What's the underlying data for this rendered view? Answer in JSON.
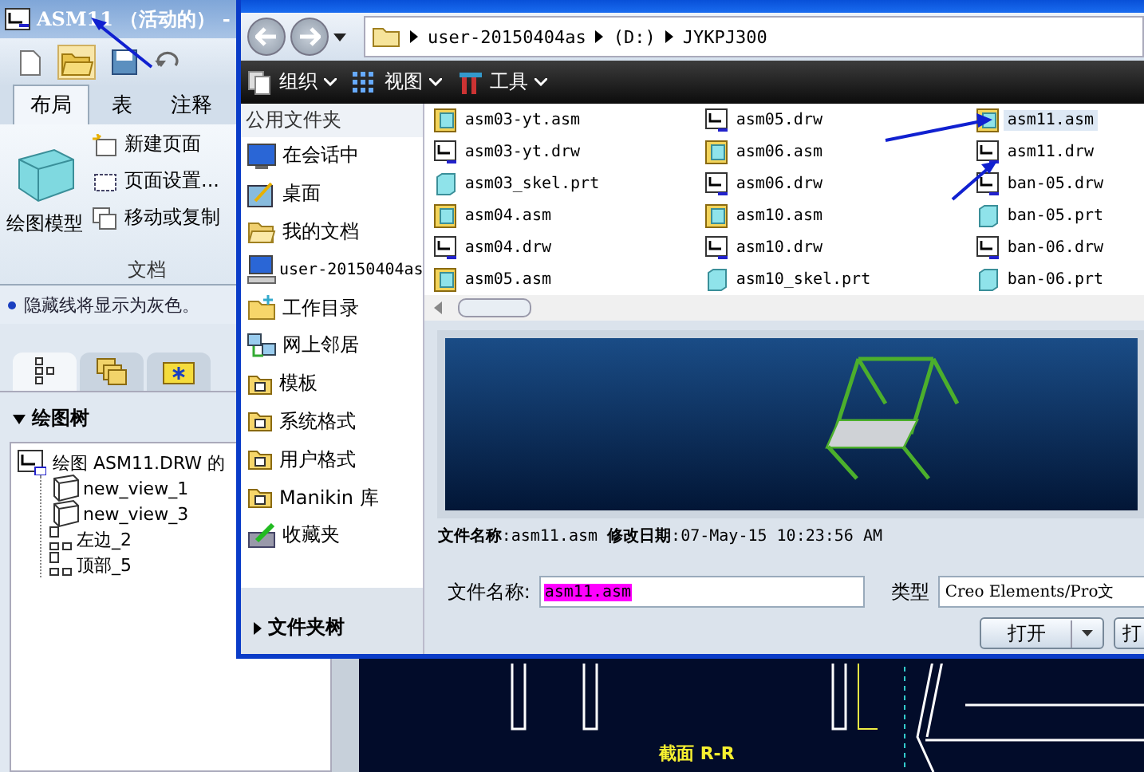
{
  "app": {
    "title": "ASM11 （活动的） -",
    "ribbon_tabs": [
      {
        "label": "布局",
        "selected": true
      },
      {
        "label": "表",
        "selected": false
      },
      {
        "label": "注释",
        "selected": false
      }
    ],
    "ribbon": {
      "big_button": "绘图模型",
      "commands": [
        {
          "label": "新建页面",
          "kind": "new"
        },
        {
          "label": "页面设置...",
          "kind": "setup"
        },
        {
          "label": "移动或复制",
          "kind": "move"
        }
      ],
      "group_label": "文档"
    },
    "message": "隐藏线将显示为灰色。",
    "panel_tabs": [
      {
        "kind": "tree",
        "selected": true
      },
      {
        "kind": "layers",
        "selected": false
      },
      {
        "kind": "star-folder",
        "selected": false
      }
    ],
    "tree": {
      "title": "绘图树",
      "expanded": true,
      "root": {
        "label": "绘图 ASM11.DRW 的",
        "children": [
          {
            "label": "new_view_1",
            "kind": "view"
          },
          {
            "label": "new_view_3",
            "kind": "view"
          },
          {
            "label": "左边_2",
            "kind": "projection"
          },
          {
            "label": "顶部_5",
            "kind": "projection"
          }
        ]
      }
    },
    "canvas": {
      "section_label": "截面 R-R"
    }
  },
  "dialog": {
    "address": [
      "user-20150404as",
      "(D:)",
      "JYKPJ300"
    ],
    "toolbar": [
      {
        "label": "组织",
        "kind": "organize"
      },
      {
        "label": "视图",
        "kind": "view"
      },
      {
        "label": "工具",
        "kind": "tools"
      }
    ],
    "nav_header": "公用文件夹",
    "nav": [
      {
        "label": "在会话中",
        "kind": "session"
      },
      {
        "label": "桌面",
        "kind": "desktop"
      },
      {
        "label": "我的文档",
        "kind": "documents"
      },
      {
        "label": "user-20150404as",
        "kind": "computer"
      },
      {
        "label": "工作目录",
        "kind": "workdir"
      },
      {
        "label": "网上邻居",
        "kind": "network"
      },
      {
        "label": "模板",
        "kind": "folder"
      },
      {
        "label": "系统格式",
        "kind": "folder"
      },
      {
        "label": "用户格式",
        "kind": "folder"
      },
      {
        "label": "Manikin 库",
        "kind": "folder"
      },
      {
        "label": "收藏夹",
        "kind": "favorites"
      }
    ],
    "folder_tree": {
      "label": "文件夹树",
      "expanded": false
    },
    "files": [
      {
        "name": "asm03-yt.asm",
        "kind": "asm",
        "selected": false
      },
      {
        "name": "asm03-yt.drw",
        "kind": "drw",
        "selected": false
      },
      {
        "name": "asm03_skel.prt",
        "kind": "prt",
        "selected": false
      },
      {
        "name": "asm04.asm",
        "kind": "asm",
        "selected": false
      },
      {
        "name": "asm04.drw",
        "kind": "drw",
        "selected": false
      },
      {
        "name": "asm05.asm",
        "kind": "asm",
        "selected": false
      },
      {
        "name": "asm05.drw",
        "kind": "drw",
        "selected": false
      },
      {
        "name": "asm06.asm",
        "kind": "asm",
        "selected": false
      },
      {
        "name": "asm06.drw",
        "kind": "drw",
        "selected": false
      },
      {
        "name": "asm10.asm",
        "kind": "asm",
        "selected": false
      },
      {
        "name": "asm10.drw",
        "kind": "drw",
        "selected": false
      },
      {
        "name": "asm10_skel.prt",
        "kind": "prt",
        "selected": false
      },
      {
        "name": "asm11.asm",
        "kind": "asm",
        "selected": true
      },
      {
        "name": "asm11.drw",
        "kind": "drw",
        "selected": false
      },
      {
        "name": "ban-05.drw",
        "kind": "drw",
        "selected": false
      },
      {
        "name": "ban-05.prt",
        "kind": "prt",
        "selected": false
      },
      {
        "name": "ban-06.drw",
        "kind": "drw",
        "selected": false
      },
      {
        "name": "ban-06.prt",
        "kind": "prt",
        "selected": false
      }
    ],
    "info": "**文件名称**:asm11.asm **修改日期**:07-May-15 10:23:56 AM",
    "filename": {
      "label": "文件名称:",
      "value": "asm11.asm"
    },
    "type": {
      "label": "类型",
      "value": "Creo Elements/Pro文"
    },
    "buttons": [
      {
        "label": "打开",
        "kind": "split"
      },
      {
        "label": "打",
        "kind": "plain"
      }
    ]
  }
}
